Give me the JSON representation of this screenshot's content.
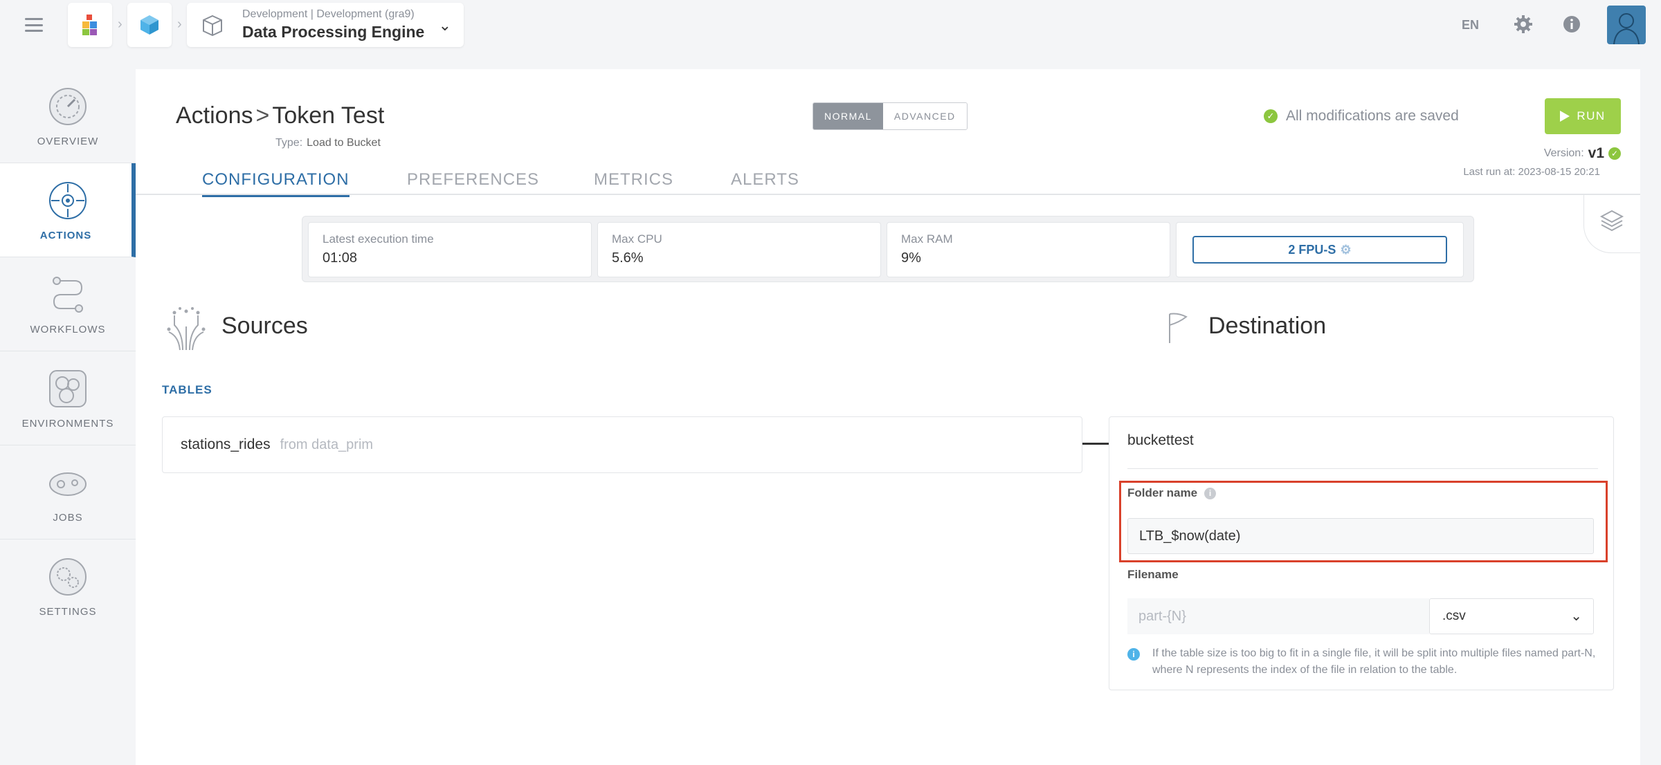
{
  "topbar": {
    "env_subtitle": "Development | Development (gra9)",
    "env_title": "Data Processing Engine",
    "lang": "EN"
  },
  "sidebar": {
    "items": [
      {
        "label": "OVERVIEW"
      },
      {
        "label": "ACTIONS"
      },
      {
        "label": "WORKFLOWS"
      },
      {
        "label": "ENVIRONMENTS"
      },
      {
        "label": "JOBS"
      },
      {
        "label": "SETTINGS"
      }
    ]
  },
  "header": {
    "section": "Actions",
    "separator": ">",
    "title": "Token Test",
    "type_label": "Type:",
    "type_value": "Load to Bucket",
    "mode_normal": "NORMAL",
    "mode_advanced": "ADVANCED",
    "saved_text": "All modifications are saved",
    "run_label": "RUN",
    "version_label": "Version:",
    "version_value": "v1",
    "last_run": "Last run at: 2023-08-15 20:21"
  },
  "tabs": [
    "CONFIGURATION",
    "PREFERENCES",
    "METRICS",
    "ALERTS"
  ],
  "metrics": {
    "exec_label": "Latest execution time",
    "exec_value": "01:08",
    "cpu_label": "Max CPU",
    "cpu_value": "5.6%",
    "ram_label": "Max RAM",
    "ram_value": "9%",
    "fpu": "2 FPU-S"
  },
  "sources": {
    "title": "Sources",
    "tables_label": "TABLES",
    "table_name": "stations_rides",
    "table_from": "from data_prim"
  },
  "destination": {
    "title": "Destination",
    "bucket": "buckettest",
    "folder_label": "Folder name",
    "folder_value": "LTB_$now(date)",
    "filename_label": "Filename",
    "filename_placeholder": "part-{N}",
    "extension": ".csv",
    "note": "If the table size is too big to fit in a single file, it will be split into multiple files named part-N, where N represents the index of the file in relation to the table."
  },
  "colors": {
    "accent": "#2e6ea6",
    "run": "#9ed04a",
    "saved": "#8cc63f",
    "highlight": "#d9412b"
  }
}
